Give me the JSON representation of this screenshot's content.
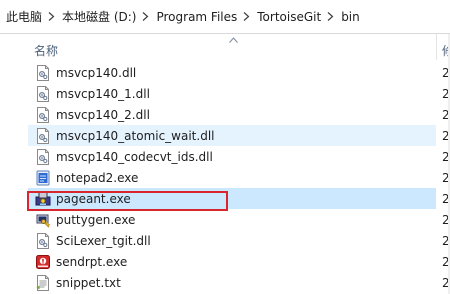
{
  "breadcrumb": {
    "items": [
      {
        "label": "此电脑"
      },
      {
        "label": "本地磁盘 (D:)"
      },
      {
        "label": "Program Files"
      },
      {
        "label": "TortoiseGit"
      },
      {
        "label": "bin"
      }
    ]
  },
  "header": {
    "name_col": "名称",
    "second_col": "修"
  },
  "files": [
    {
      "name": "msvcp140.dll",
      "icon": "dll-file-icon",
      "trunc": "2"
    },
    {
      "name": "msvcp140_1.dll",
      "icon": "dll-file-icon",
      "trunc": "2"
    },
    {
      "name": "msvcp140_2.dll",
      "icon": "dll-file-icon",
      "trunc": "2"
    },
    {
      "name": "msvcp140_atomic_wait.dll",
      "icon": "dll-file-icon",
      "trunc": "2",
      "state": "hover"
    },
    {
      "name": "msvcp140_codecvt_ids.dll",
      "icon": "dll-file-icon",
      "trunc": "2"
    },
    {
      "name": "notepad2.exe",
      "icon": "notepad2-app-icon",
      "trunc": "2"
    },
    {
      "name": "pageant.exe",
      "icon": "pageant-app-icon",
      "trunc": "2",
      "state": "selected"
    },
    {
      "name": "puttygen.exe",
      "icon": "puttygen-app-icon",
      "trunc": "2"
    },
    {
      "name": "SciLexer_tgit.dll",
      "icon": "dll-file-icon",
      "trunc": "2"
    },
    {
      "name": "sendrpt.exe",
      "icon": "sendrpt-app-icon",
      "trunc": "2"
    },
    {
      "name": "snippet.txt",
      "icon": "text-file-icon",
      "trunc": "2"
    }
  ],
  "colors": {
    "hover": "#e5f3ff",
    "selected": "#cce8ff",
    "highlight_border": "#d9262d",
    "header_text": "#4c607a"
  }
}
